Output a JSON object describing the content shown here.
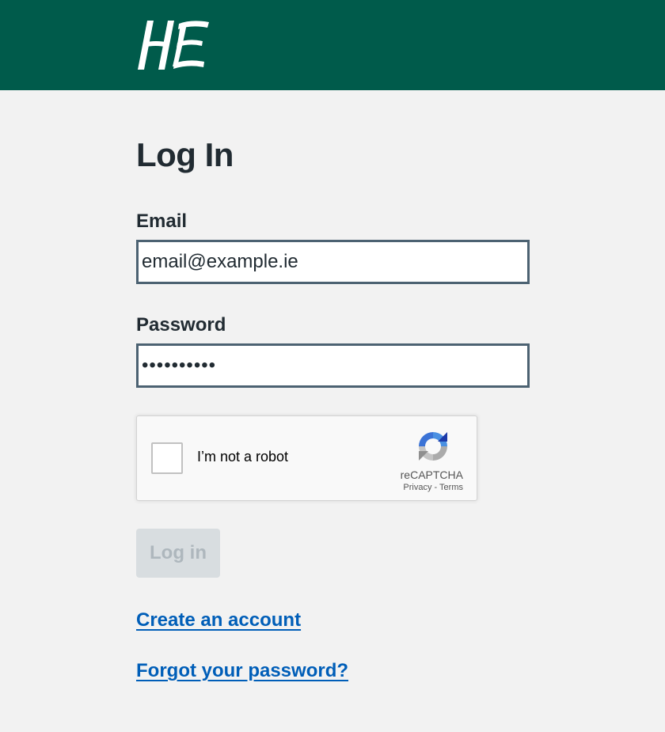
{
  "header": {
    "logo_text": "HSE",
    "bg_color": "#005b4b",
    "logo_icon": "hse-logo"
  },
  "main": {
    "title": "Log In",
    "email": {
      "label": "Email",
      "value": "email@example.ie"
    },
    "password": {
      "label": "Password",
      "value": "••••••••••"
    },
    "recaptcha": {
      "label": "I’m not a robot",
      "brand": "reCAPTCHA",
      "privacy": "Privacy",
      "separator": " - ",
      "terms": "Terms",
      "icon": "recaptcha-logo",
      "checked": false
    },
    "login_button": {
      "label": "Log in",
      "disabled": true
    },
    "links": {
      "create_account": "Create an account",
      "forgot_password": "Forgot your password?"
    }
  },
  "colors": {
    "accent": "#005b4b",
    "link": "#005eb8",
    "text": "#212b32",
    "input_border": "#4c6272",
    "background": "#f2f2f2"
  }
}
